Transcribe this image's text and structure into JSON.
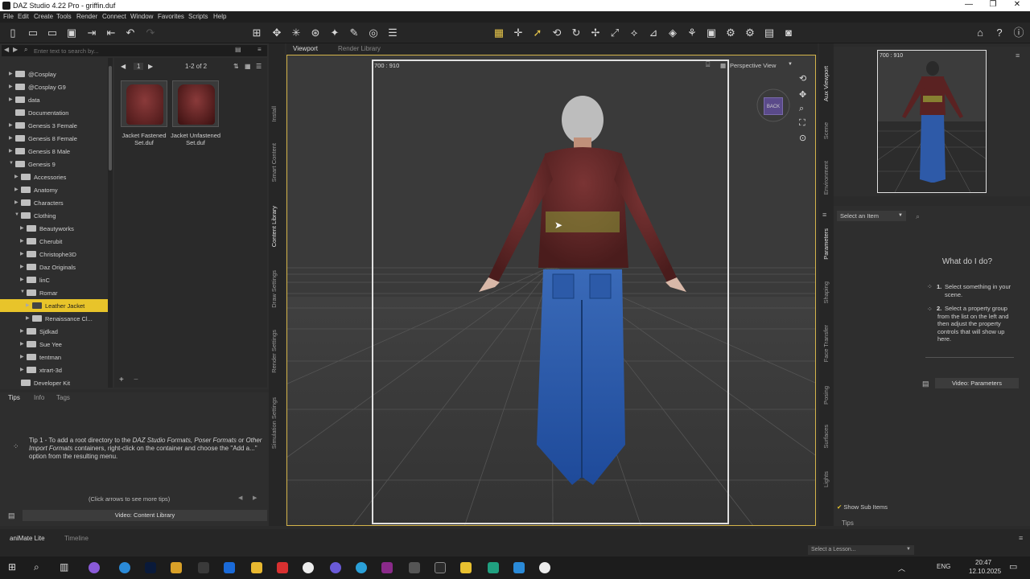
{
  "window": {
    "title": "DAZ Studio 4.22 Pro - griffin.duf",
    "minimize": "—",
    "maximize": "❐",
    "close": "✕"
  },
  "menu": [
    "File",
    "Edit",
    "Create",
    "Tools",
    "Render",
    "Connect",
    "Window",
    "Favorites",
    "Scripts",
    "Help"
  ],
  "search": {
    "placeholder": "Enter text to search by..."
  },
  "tree": [
    {
      "label": "@Cosplay",
      "indent": 1,
      "arrow": "▶"
    },
    {
      "label": "@Cosplay G9",
      "indent": 1,
      "arrow": "▶"
    },
    {
      "label": "data",
      "indent": 1,
      "arrow": "▶"
    },
    {
      "label": "Documentation",
      "indent": 1,
      "arrow": ""
    },
    {
      "label": "Genesis 3 Female",
      "indent": 1,
      "arrow": "▶"
    },
    {
      "label": "Genesis 8 Female",
      "indent": 1,
      "arrow": "▶"
    },
    {
      "label": "Genesis 8 Male",
      "indent": 1,
      "arrow": "▶"
    },
    {
      "label": "Genesis 9",
      "indent": 1,
      "arrow": "▼"
    },
    {
      "label": "Accessories",
      "indent": 2,
      "arrow": "▶"
    },
    {
      "label": "Anatomy",
      "indent": 2,
      "arrow": "▶"
    },
    {
      "label": "Characters",
      "indent": 2,
      "arrow": "▶"
    },
    {
      "label": "Clothing",
      "indent": 2,
      "arrow": "▼"
    },
    {
      "label": "Beautyworks",
      "indent": 3,
      "arrow": "▶"
    },
    {
      "label": "Cherubit",
      "indent": 3,
      "arrow": "▶"
    },
    {
      "label": "Christophe3D",
      "indent": 3,
      "arrow": "▶"
    },
    {
      "label": "Daz Originals",
      "indent": 3,
      "arrow": "▶"
    },
    {
      "label": "linC",
      "indent": 3,
      "arrow": "▶"
    },
    {
      "label": "Romar",
      "indent": 3,
      "arrow": "▼"
    },
    {
      "label": "Leather Jacket",
      "indent": 4,
      "arrow": "▶",
      "selected": true
    },
    {
      "label": "Renaissance Cl...",
      "indent": 4,
      "arrow": "▶"
    },
    {
      "label": "Sjdkad",
      "indent": 3,
      "arrow": "▶"
    },
    {
      "label": "Sue Yee",
      "indent": 3,
      "arrow": "▶"
    },
    {
      "label": "tentman",
      "indent": 3,
      "arrow": "▶"
    },
    {
      "label": "xtrart-3d",
      "indent": 3,
      "arrow": "▶"
    },
    {
      "label": "Developer Kit",
      "indent": 2,
      "arrow": ""
    }
  ],
  "content": {
    "page": "1",
    "count": "1-2 of 2",
    "items": [
      {
        "label1": "Jacket Fastened",
        "label2": "Set.duf"
      },
      {
        "label1": "Jacket Unfastened",
        "label2": "Set.duf"
      }
    ]
  },
  "left_vtabs": [
    "Install",
    "Smart Content",
    "Content Library",
    "Draw Settings",
    "Render Settings",
    "Simulation Settings"
  ],
  "tips": {
    "tabs": [
      "Tips",
      "Info",
      "Tags"
    ],
    "text_1": "Tip 1 - To add a root directory to the ",
    "text_2": "DAZ Studio Formats, Poser Formats",
    "text_3": " or ",
    "text_4": "Other Import Formats",
    "text_5": " containers, right-click on the container and choose the \"Add a...\" option from the resulting menu.",
    "nav": "(Click arrows to see more tips)",
    "video": "Video: Content Library"
  },
  "viewport": {
    "tabs": [
      "Viewport",
      "Render Library"
    ],
    "aspect": "700 : 910",
    "camera": "Perspective View",
    "cube": "BACK"
  },
  "aux": {
    "aspect": "700 : 910",
    "vtabs": [
      "Aux Viewport",
      "Scene",
      "Environment"
    ]
  },
  "params": {
    "vtabs": [
      "Parameters",
      "Shaping",
      "Face Transfer",
      "Posing",
      "Surfaces",
      "Lights"
    ],
    "select": "Select an Item",
    "what": "What do I do?",
    "step1_num": "1.",
    "step1": "Select something in your scene.",
    "step2_num": "2.",
    "step2": "Select a property group from the list on the left and then adjust the property controls that will show up here.",
    "video": "Video: Parameters",
    "show_sub": "Show Sub Items",
    "tips_tab": "Tips"
  },
  "bottom": {
    "tabs": [
      "aniMate Lite",
      "Timeline"
    ],
    "lesson": "Select a Lesson..."
  },
  "taskbar": {
    "lang": "ENG",
    "time": "20:47",
    "date": "12.10.2025"
  },
  "colors": {
    "accent": "#e8c42a",
    "viewport_border": "#d4b44a",
    "jacket": "#6a2a2a",
    "jeans": "#2a5aa8"
  }
}
